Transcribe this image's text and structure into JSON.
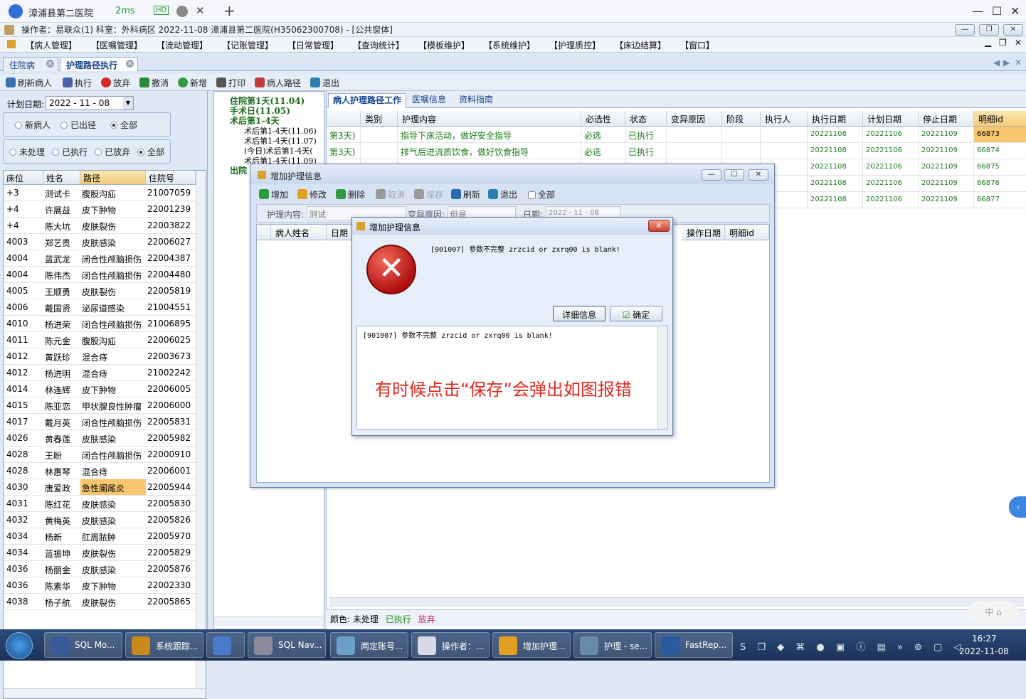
{
  "window": {
    "app_title": "漳浦县第二医院",
    "ping": "2ms",
    "hd_badge": "HD",
    "add_tab_symbol": "+",
    "info_line": "操作者：易联众(1)  科室：外科病区  2022-11-08  漳浦县第二医院(H35062300708) - [公共窗体]"
  },
  "menu": [
    "【病人管理】",
    "【医嘱管理】",
    "【流动管理】",
    "【记账管理】",
    "【日常管理】",
    "【查询统计】",
    "【模板维护】",
    "【系统维护】",
    "【护理质控】",
    "【床边结算】",
    "【窗口】"
  ],
  "tabs": [
    {
      "label": "住院病人"
    },
    {
      "label": "护理路径执行"
    }
  ],
  "toolbar": [
    {
      "label": "刷新病人",
      "icon": "search-icon",
      "color": "#3a6fb0"
    },
    {
      "label": "执行",
      "icon": "gear-icon",
      "color": "#4a60a8"
    },
    {
      "label": "放弃",
      "icon": "ban-icon",
      "color": "#d02a2a"
    },
    {
      "label": "撤消",
      "icon": "undo-icon",
      "color": "#2d8a3a"
    },
    {
      "label": "新增",
      "icon": "plus-icon",
      "color": "#2f9a3f"
    },
    {
      "label": "打印",
      "icon": "printer-icon",
      "color": "#555555"
    },
    {
      "label": "病人路径",
      "icon": "patient-icon",
      "color": "#c23b3b"
    },
    {
      "label": "退出",
      "icon": "exit-icon",
      "color": "#2a7fb0"
    }
  ],
  "left": {
    "plan_date_label": "计划日期:",
    "plan_date_value": "2022 - 11 - 08",
    "radios_a": [
      {
        "label": "新病人",
        "on": false
      },
      {
        "label": "已出径",
        "on": false
      },
      {
        "label": "全部",
        "on": true
      }
    ],
    "radios_b": [
      {
        "label": "未处理",
        "on": false
      },
      {
        "label": "已执行",
        "on": false
      },
      {
        "label": "已放弃",
        "on": false
      },
      {
        "label": "全部",
        "on": true
      }
    ],
    "columns": [
      "床位",
      "姓名",
      "路径",
      "住院号"
    ],
    "rows": [
      [
        "+3",
        "测试卡",
        "腹股沟疝",
        "21007059"
      ],
      [
        "+4",
        "许展益",
        "皮下肿物",
        "22001239"
      ],
      [
        "+4",
        "陈大坑",
        "皮肤裂伤",
        "22003822"
      ],
      [
        "4003",
        "郑艺贵",
        "皮肤感染",
        "22006027"
      ],
      [
        "4004",
        "蓝武龙",
        "闭合性颅脑损伤",
        "22004387"
      ],
      [
        "4004",
        "陈伟杰",
        "闭合性颅脑损伤",
        "22004480"
      ],
      [
        "4005",
        "王顺勇",
        "皮肤裂伤",
        "22005819"
      ],
      [
        "4006",
        "戴国贤",
        "泌尿道感染",
        "21004551"
      ],
      [
        "4010",
        "杨进荣",
        "闭合性颅脑损伤",
        "21006895"
      ],
      [
        "4011",
        "陈元金",
        "腹股沟疝",
        "22006025"
      ],
      [
        "4012",
        "黄跃珍",
        "混合痔",
        "22003673"
      ],
      [
        "4012",
        "杨进明",
        "混合痔",
        "21002242"
      ],
      [
        "4014",
        "林连辉",
        "皮下肿物",
        "22006005"
      ],
      [
        "4015",
        "陈亚恋",
        "甲状腺良性肿瘤",
        "22006000"
      ],
      [
        "4017",
        "戴月英",
        "闭合性颅脑损伤",
        "22005831"
      ],
      [
        "4026",
        "黄春莲",
        "皮肤感染",
        "22005982"
      ],
      [
        "4028",
        "王盼",
        "闭合性颅脑损伤",
        "22000910"
      ],
      [
        "4028",
        "林惠琴",
        "混合痔",
        "22006001"
      ],
      [
        "4030",
        "唐爱政",
        "急性阑尾炎",
        "22005944"
      ],
      [
        "4031",
        "陈红花",
        "皮肤感染",
        "22005830"
      ],
      [
        "4032",
        "黄梅英",
        "皮肤感染",
        "22005826"
      ],
      [
        "4034",
        "杨新",
        "肛周脓肿",
        "22005970"
      ],
      [
        "4034",
        "蓝振坤",
        "皮肤裂伤",
        "22005829"
      ],
      [
        "4036",
        "杨丽金",
        "皮肤感染",
        "22005876"
      ],
      [
        "4036",
        "陈素华",
        "皮下肿物",
        "22002330"
      ],
      [
        "4038",
        "杨子航",
        "皮肤裂伤",
        "22005865"
      ]
    ],
    "highlight_row": 18
  },
  "tree": [
    {
      "label": "住院第1天(11.04)",
      "level": 0,
      "bold": true
    },
    {
      "label": "手术日(11.05)",
      "level": 0,
      "bold": true
    },
    {
      "label": "术后第1-4天",
      "level": 0,
      "bold": true
    },
    {
      "label": "术后第1-4天(11.06)",
      "level": 1,
      "bold": false
    },
    {
      "label": "术后第1-4天(11.07)",
      "level": 1,
      "bold": false
    },
    {
      "label": "(今日)术后第1-4天(",
      "level": 1,
      "bold": false
    },
    {
      "label": "术后第1-4天(11.09)",
      "level": 1,
      "bold": false
    },
    {
      "label": "出院",
      "level": 0,
      "bold": true
    }
  ],
  "right": {
    "subtabs": [
      "病人护理路径工作",
      "医嘱信息",
      "资料指南"
    ],
    "columns": [
      "",
      "类别",
      "护理内容",
      "必选性",
      "状态",
      "变异原因",
      "阶段",
      "执行人",
      "执行日期",
      "计划日期",
      "停止日期",
      "明细id"
    ],
    "rows": [
      [
        "第3天)",
        "",
        "指导下床活动，做好安全指导",
        "必选",
        "已执行",
        "",
        "",
        "",
        "20221108",
        "20221106",
        "20221109",
        "66873"
      ],
      [
        "第3天)",
        "",
        "排气后进流质饮食，做好饮食指导",
        "必选",
        "已执行",
        "",
        "",
        "",
        "20221108",
        "20221106",
        "20221109",
        "66874"
      ],
      [
        "",
        "",
        "",
        "",
        "",
        "",
        "",
        "",
        "20221108",
        "20221106",
        "20221109",
        "66875"
      ],
      [
        "",
        "",
        "",
        "",
        "",
        "",
        "",
        "",
        "20221108",
        "20221106",
        "20221109",
        "66876"
      ],
      [
        "",
        "",
        "",
        "",
        "",
        "",
        "",
        "",
        "20221108",
        "20221106",
        "20221109",
        "66877"
      ]
    ],
    "legend_prefix": "颜色:",
    "legend": [
      {
        "label": "未处理",
        "color": "#000000"
      },
      {
        "label": "已执行",
        "color": "#1a8a1a"
      },
      {
        "label": "放弃",
        "color": "#c0306a"
      }
    ]
  },
  "dialog1": {
    "title": "增加护理信息",
    "toolbar": [
      {
        "label": "增加",
        "icon": "plus-icon",
        "enabled": true
      },
      {
        "label": "修改",
        "icon": "edit-icon",
        "enabled": true
      },
      {
        "label": "删除",
        "icon": "minus-icon",
        "enabled": true
      },
      {
        "label": "取消",
        "icon": "undo-icon",
        "enabled": false
      },
      {
        "label": "保存",
        "icon": "save-icon",
        "enabled": false
      },
      {
        "label": "刷新",
        "icon": "refresh-icon",
        "enabled": true
      },
      {
        "label": "退出",
        "icon": "exit-icon",
        "enabled": true
      },
      {
        "label": "全部",
        "icon": "checkbox-icon",
        "enabled": true
      }
    ],
    "content_label": "护理内容:",
    "content_value": "测试",
    "variance_label": "变异原因:",
    "variance_value": "但是",
    "date_label": "日期:",
    "date_value": "2022 - 11 - 08",
    "columns_left": [
      "病人姓名",
      "日期"
    ],
    "columns_right": [
      "操作日期",
      "明细id"
    ]
  },
  "dialog2": {
    "title": "增加护理信息",
    "message": "[901007] 参数不完整 zrzcid or zxrq00 is blank!",
    "detail_button": "详细信息",
    "ok_button": "确定",
    "detail_text": "[901007] 参数不完整 zrzcid or zxrq00 is blank!",
    "annotation": "有时候点击“保存”会弹出如图报错"
  },
  "taskbar": {
    "items": [
      {
        "label": "SQL Mo...",
        "color": "#3a5a9a"
      },
      {
        "label": "系统跟踪...",
        "color": "#c88a1a"
      },
      {
        "label": "",
        "color": "#4a7acc"
      },
      {
        "label": "SQL Nav...",
        "color": "#8a8a9a"
      },
      {
        "label": "两定账号...",
        "color": "#6aa0c8"
      },
      {
        "label": "操作者：...",
        "color": "#d8d8e8"
      },
      {
        "label": "增加护理...",
        "color": "#e0a020"
      },
      {
        "label": "护理 - se...",
        "color": "#6a8aaa"
      },
      {
        "label": "FastRep...",
        "color": "#2a5aa0"
      }
    ],
    "time": "16:27",
    "date": "2022-11-08"
  }
}
